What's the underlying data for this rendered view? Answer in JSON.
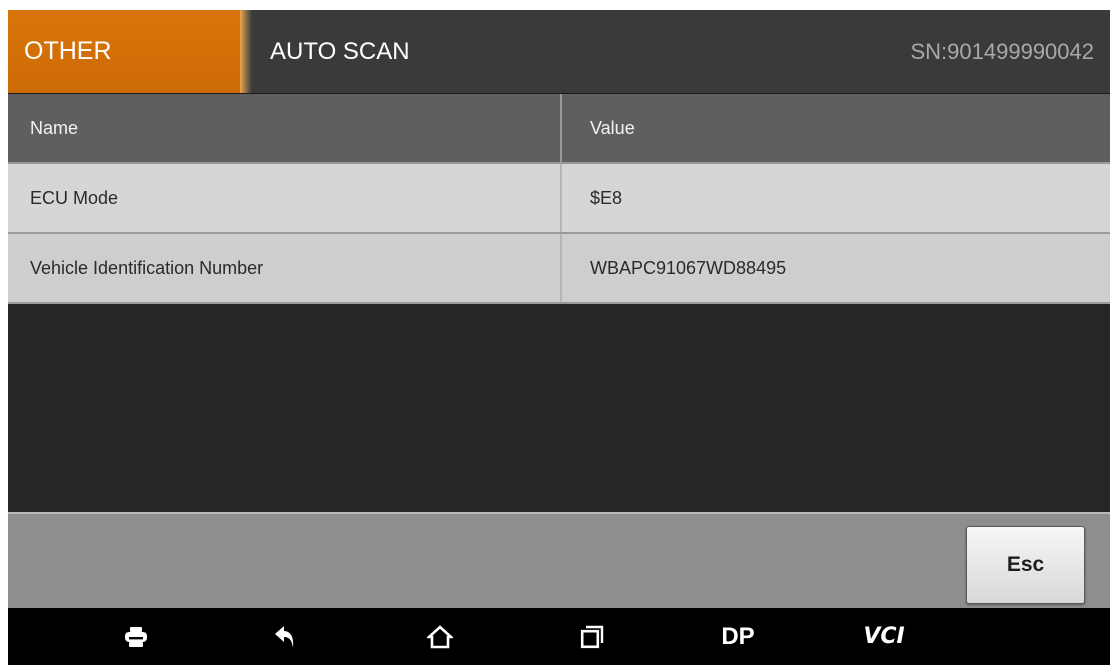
{
  "header": {
    "active_tab": "OTHER",
    "title": "AUTO SCAN",
    "serial": "SN:901499990042"
  },
  "table": {
    "columns": [
      "Name",
      "Value"
    ],
    "rows": [
      {
        "name": "ECU Mode",
        "value": "$E8"
      },
      {
        "name": "Vehicle Identification Number",
        "value": "WBAPC91067WD88495"
      }
    ]
  },
  "actions": {
    "esc_label": "Esc"
  },
  "navbar": {
    "items": [
      {
        "icon": "print-icon"
      },
      {
        "icon": "back-icon"
      },
      {
        "icon": "home-icon"
      },
      {
        "icon": "recent-apps-icon"
      },
      {
        "icon": "dp-icon",
        "label": "DP"
      },
      {
        "icon": "vci-icon",
        "label": "VCI"
      }
    ]
  },
  "colors": {
    "accent": "#d9750a",
    "header_bg": "#3a3a3a",
    "table_head_bg": "#5f5f5f",
    "row_bg": "#d6d6d6",
    "action_bar_bg": "#8e8e8e"
  }
}
